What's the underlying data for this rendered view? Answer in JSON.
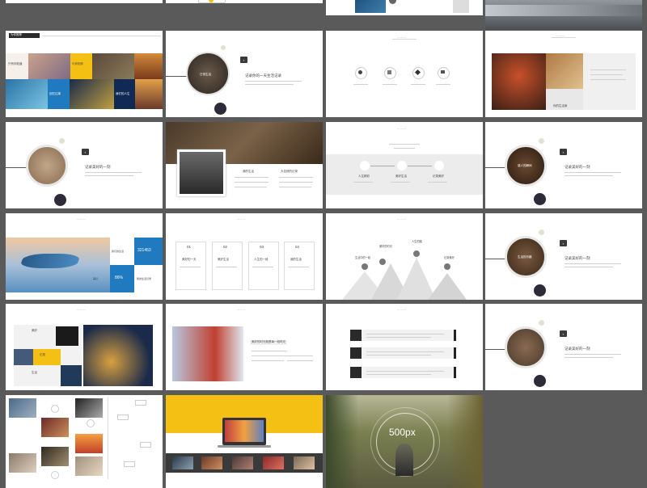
{
  "window": {
    "background": "#5a5a5a",
    "accent_yellow": "#f5c014",
    "accent_blue": "#1f7ac0",
    "accent_dark": "#2f2a3a"
  },
  "row2": {
    "s1": {
      "title": "为你推荐",
      "labels": [
        "只有你知道",
        "与你相伴",
        "回忆往事",
        "我们的人生"
      ]
    },
    "s2": {
      "circle_label": "日常生活",
      "heading": "记录你的一天生活记录"
    },
    "s4": {
      "caption": "你的生活家"
    }
  },
  "row3": {
    "s1": {
      "heading": "记录美好的一刻"
    },
    "s2": {
      "col1": "我的生活",
      "col2": "大自然的记录"
    },
    "s3": {
      "labels": [
        "人生精彩",
        "美好生活",
        "记录美好"
      ]
    },
    "s4": {
      "circle_label": "感人的瞬间",
      "heading": "记录美好的一刻"
    }
  },
  "row4": {
    "s1": {
      "labels": [
        "我们的生活",
        "美好",
        "我的生活记录"
      ],
      "number": "321453",
      "percent": "86%"
    },
    "s2": {
      "cards": [
        {
          "num": "01",
          "label": "美好的一天"
        },
        {
          "num": "02",
          "label": "美好生活"
        },
        {
          "num": "03",
          "label": "人生的一段"
        },
        {
          "num": "04",
          "label": "我的生活"
        }
      ]
    },
    "s3": {
      "labels": [
        "生活中的一段",
        "美好的时光",
        "人生的路",
        "记录美好"
      ]
    },
    "s4": {
      "circle_label": "生活的乐趣",
      "heading": "记录美好的一刻"
    }
  },
  "row5": {
    "s1": {
      "labels": [
        "美好",
        "记录",
        "生活"
      ]
    },
    "s2": {
      "heading": "美好的时光就是每一段时光"
    },
    "s4": {
      "heading": "记录美好的一刻"
    }
  },
  "row6": {
    "s3": {
      "logo": "500px"
    }
  }
}
